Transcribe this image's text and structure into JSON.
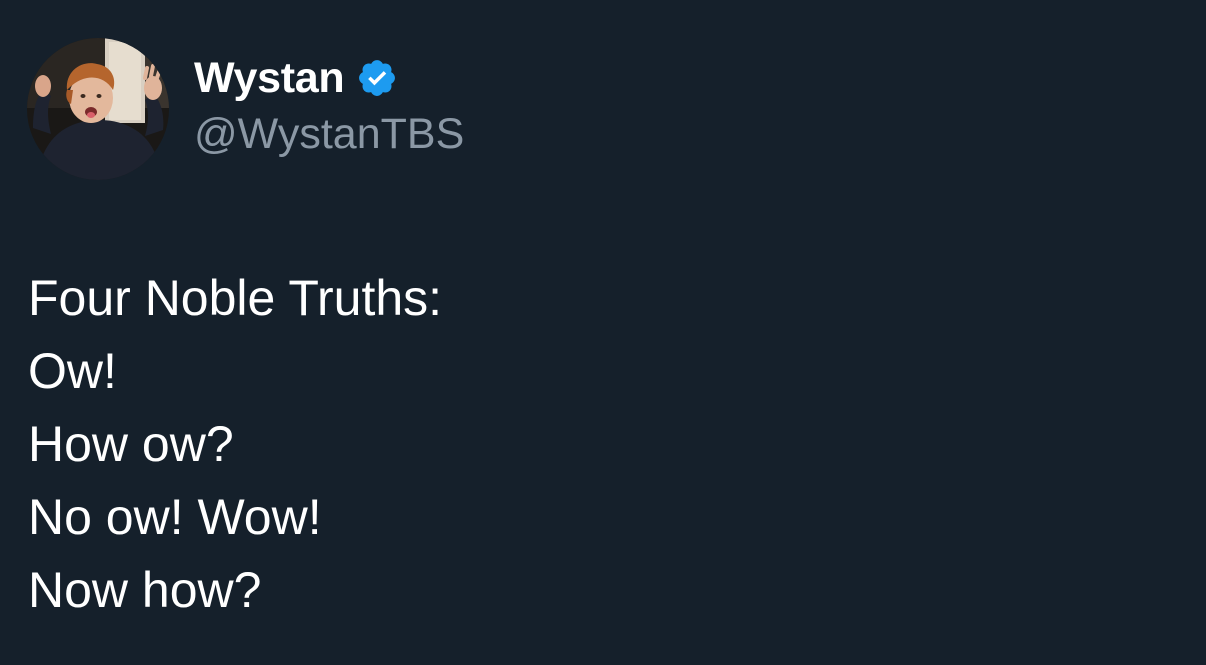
{
  "author": {
    "display_name": "Wystan",
    "handle": "@WystanTBS",
    "verified": true,
    "verified_badge_icon": "verified-badge-icon",
    "avatar": "avatar-photo"
  },
  "tweet": {
    "lines": [
      "Four Noble Truths:",
      "Ow!",
      "How ow?",
      "No ow! Wow!",
      "Now how?"
    ]
  },
  "colors": {
    "background": "#15202b",
    "text": "#ffffff",
    "secondary_text": "#8b98a5",
    "verified_blue": "#1d9bf0"
  }
}
